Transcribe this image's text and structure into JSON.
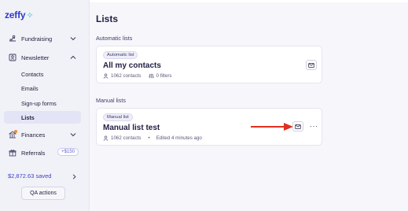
{
  "brand": {
    "name": "zeffy",
    "mark": "✧"
  },
  "sidebar": {
    "items": [
      {
        "label": "Fundraising",
        "icon": "fundraising-icon"
      },
      {
        "label": "Newsletter",
        "icon": "newsletter-icon"
      },
      {
        "label": "Finances",
        "icon": "finances-icon"
      },
      {
        "label": "Referrals",
        "icon": "gift-icon",
        "badge": "+$150"
      }
    ],
    "newsletter_sub": [
      {
        "label": "Contacts"
      },
      {
        "label": "Emails"
      },
      {
        "label": "Sign-up forms"
      },
      {
        "label": "Lists",
        "active": true
      }
    ],
    "saved": "$2,872.63 saved",
    "qa_label": "QA actions"
  },
  "main": {
    "title": "Lists",
    "automatic_section": "Automatic lists",
    "manual_section": "Manual lists",
    "automatic_card": {
      "pill": "Automatic list",
      "title": "All my contacts",
      "contacts": "1062 contacts",
      "filters": "0 filters"
    },
    "manual_card": {
      "pill": "Manual list",
      "title": "Manual list test",
      "contacts": "1062 contacts",
      "dot": "•",
      "edited": "Edited 4 minutes ago",
      "more": "···"
    }
  },
  "colors": {
    "accent": "#2f3cc4",
    "arrow": "#e0301e",
    "active_bg": "#e3e4f5",
    "notify_dot": "#f08a2b"
  }
}
